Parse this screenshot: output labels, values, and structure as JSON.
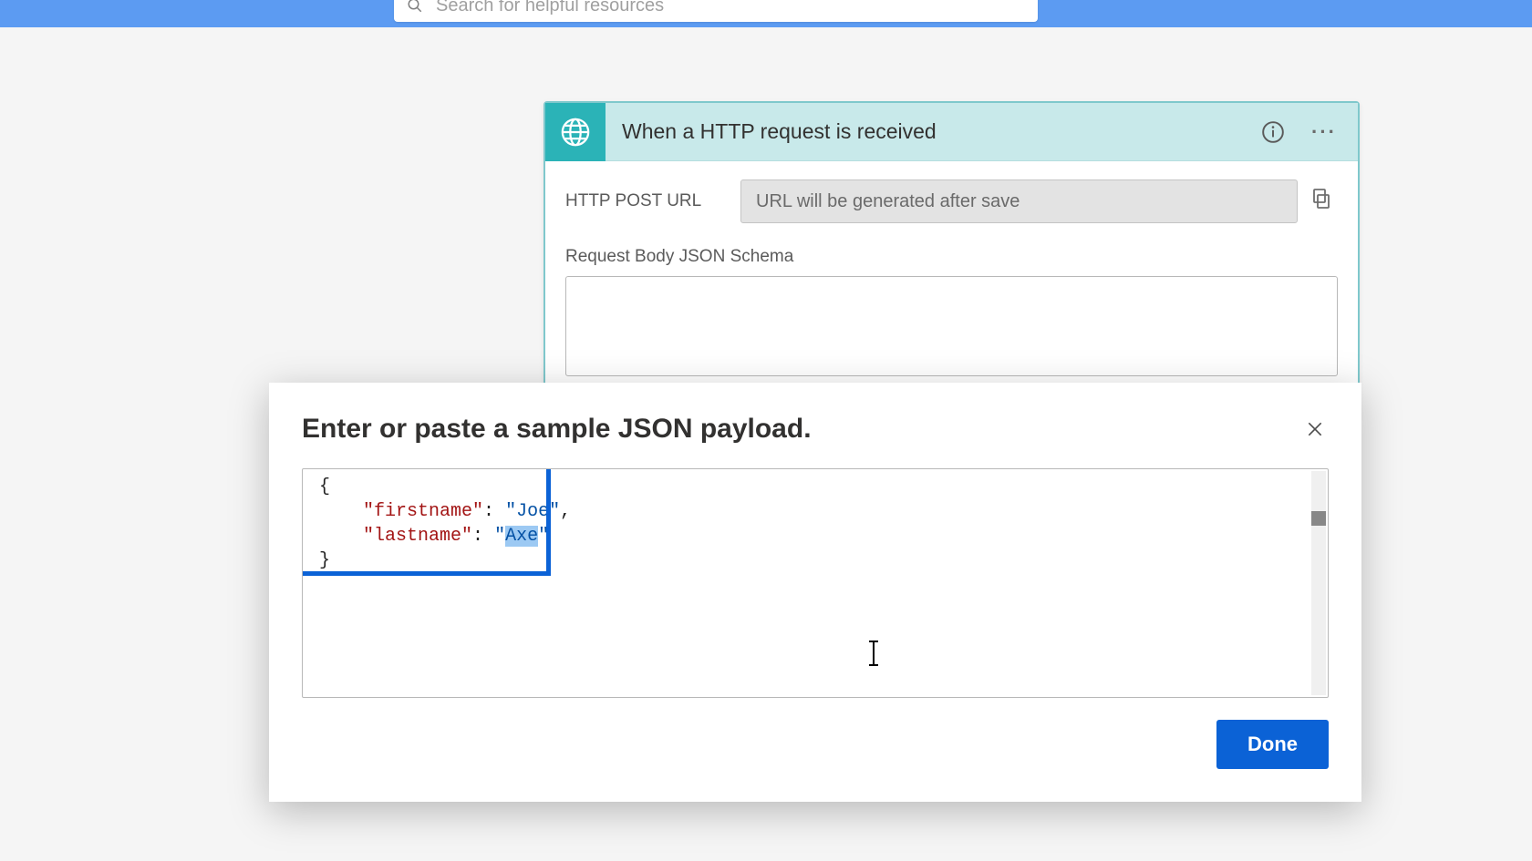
{
  "search": {
    "placeholder": "Search for helpful resources"
  },
  "trigger": {
    "title": "When a HTTP request is received",
    "url_label": "HTTP POST URL",
    "url_placeholder": "URL will be generated after save",
    "schema_label": "Request Body JSON Schema"
  },
  "modal": {
    "title": "Enter or paste a sample JSON payload.",
    "json": {
      "key1": "\"firstname\"",
      "val1": "\"Joe\"",
      "key2": "\"lastname\"",
      "val2_open": "\"",
      "val2_sel": "Axe",
      "val2_close": "\""
    },
    "done_label": "Done"
  }
}
